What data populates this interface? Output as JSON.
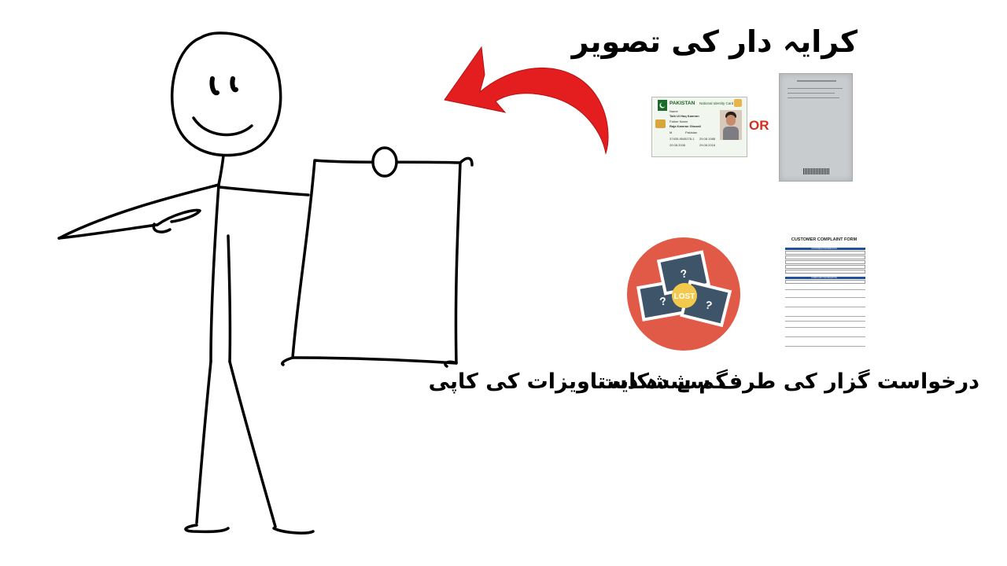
{
  "title": "کرایہ دار کی تصویر",
  "or_label": "OR",
  "caption_complaint": "درخواست گزار کی طرف سے شکایت",
  "caption_lost": "گم شدہ دستاویزات کی کاپی",
  "id_card": {
    "country": "PAKISTAN",
    "card_name": "National Identity Card",
    "name_label": "Name",
    "name": "Taib Ul Haq Kamran",
    "father_label": "Father Name",
    "father_name": "Raja Kamran Ghazali",
    "gender": "M",
    "country_of_stay": "Pakistan",
    "identity_number": "37405-9545278-1",
    "date_of_issue": "29.08.2008",
    "date_of_expiry": "29.08.2018",
    "date_of_birth": "29.08.1988"
  },
  "complaint_form": {
    "title": "CUSTOMER COMPLAINT FORM",
    "section1": "CUSTOMER INFORMATION",
    "section2": "COMPLAINT INFORMATION"
  },
  "lost_icon_label": "LOST",
  "colors": {
    "arrow": "#e41e1e",
    "lost_circle": "#e15a48",
    "lost_photo": "#3e5468",
    "lost_badge": "#f2c94c",
    "form_header": "#1f4e9a",
    "or_text": "#d32f1e"
  }
}
